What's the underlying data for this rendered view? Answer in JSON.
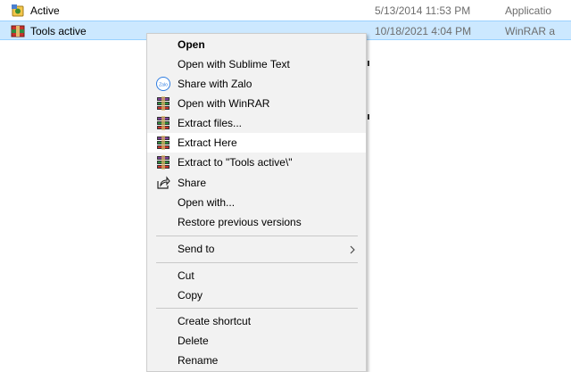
{
  "files": [
    {
      "name": "Active",
      "date": "5/13/2014 11:53 PM",
      "type": "Applicatio",
      "icon": "app-icon",
      "selected": false
    },
    {
      "name": "Tools active",
      "date": "10/18/2021 4:04 PM",
      "type": "WinRAR a",
      "icon": "winrar-archive-icon",
      "selected": true
    }
  ],
  "menu": {
    "open": "Open",
    "open_sublime": "Open with Sublime Text",
    "share_zalo": "Share with Zalo",
    "open_winrar": "Open with WinRAR",
    "extract_files": "Extract files...",
    "extract_here": "Extract Here",
    "extract_to": "Extract to \"Tools active\\\"",
    "share": "Share",
    "open_with": "Open with...",
    "restore": "Restore previous versions",
    "send_to": "Send to",
    "cut": "Cut",
    "copy": "Copy",
    "create_shortcut": "Create shortcut",
    "delete": "Delete",
    "rename": "Rename",
    "zalo_icon_text": "Zalo"
  },
  "colors": {
    "selection_bg": "#cce8ff",
    "menu_bg": "#f2f2f2",
    "hover_bg": "#ffffff"
  }
}
